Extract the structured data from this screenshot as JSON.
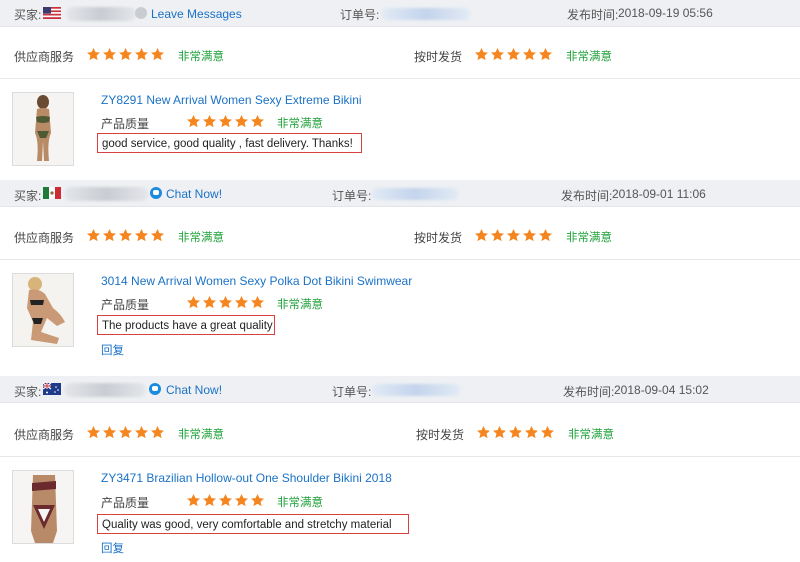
{
  "colors": {
    "star": "#f5861f",
    "rating_text": "#1fa13a",
    "link": "#1b72c6",
    "review_border": "#d94040",
    "header_bg": "#eef0f3"
  },
  "labels": {
    "buyer": "买家:",
    "order_no": "订单号:",
    "post_time_prefix": "发布时间:",
    "supplier_service": "供应商服务",
    "on_time_shipping": "按时发货",
    "product_quality": "产品质量",
    "very_satisfied": "非常满意",
    "reply": "回复"
  },
  "reviews": [
    {
      "flag": "usa-flag-icon",
      "contact_action": "Leave Messages",
      "post_time": "2018-09-19 05:56",
      "supplier_service_stars": 5,
      "on_time_shipping_stars": 5,
      "product_title": "ZY8291 New Arrival Women Sexy Extreme Bikini",
      "product_quality_stars": 5,
      "comment": "good service, good quality , fast delivery. Thanks!"
    },
    {
      "flag": "mexico-flag-icon",
      "contact_action": "Chat Now!",
      "post_time": "2018-09-01 11:06",
      "supplier_service_stars": 5,
      "on_time_shipping_stars": 5,
      "product_title": "3014 New Arrival Women Sexy Polka Dot Bikini Swimwear",
      "product_quality_stars": 5,
      "comment": "The products have a great quality"
    },
    {
      "flag": "australia-flag-icon",
      "contact_action": "Chat Now!",
      "post_time": "2018-09-04 15:02",
      "supplier_service_stars": 5,
      "on_time_shipping_stars": 5,
      "product_title": "ZY3471 Brazilian Hollow-out One Shoulder Bikini 2018",
      "product_quality_stars": 5,
      "comment": "Quality was good, very comfortable and stretchy material"
    }
  ]
}
